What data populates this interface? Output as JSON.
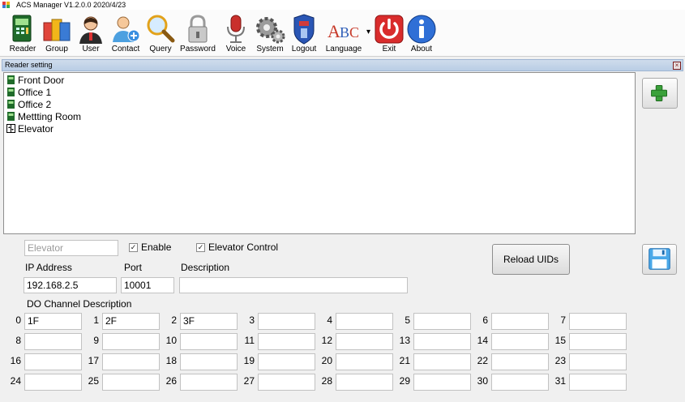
{
  "window": {
    "title": "ACS Manager V1.2.0.0  2020/4/23"
  },
  "toolbar": {
    "items": [
      {
        "label": "Reader"
      },
      {
        "label": "Group"
      },
      {
        "label": "User"
      },
      {
        "label": "Contact"
      },
      {
        "label": "Query"
      },
      {
        "label": "Password"
      },
      {
        "label": "Voice"
      },
      {
        "label": "System"
      },
      {
        "label": "Logout"
      },
      {
        "label": "Language"
      },
      {
        "label": "Exit"
      },
      {
        "label": "About"
      }
    ]
  },
  "panel": {
    "title": "Reader setting"
  },
  "tree": {
    "items": [
      {
        "label": "Front Door"
      },
      {
        "label": "Office 1"
      },
      {
        "label": "Office 2"
      },
      {
        "label": "Mettting Room"
      },
      {
        "label": "Elevator"
      }
    ]
  },
  "form": {
    "name_placeholder": "Elevator",
    "enable_label": "Enable",
    "enable_checked": true,
    "elevator_control_label": "Elevator Control",
    "elevator_control_checked": true,
    "ip_label": "IP Address",
    "ip_value": "192.168.2.5",
    "port_label": "Port",
    "port_value": "10001",
    "description_label": "Description",
    "description_value": "",
    "reload_label": "Reload UIDs",
    "do_label": "DO Channel Description"
  },
  "channels": {
    "numbers": [
      "0",
      "1",
      "2",
      "3",
      "4",
      "5",
      "6",
      "7",
      "8",
      "9",
      "10",
      "11",
      "12",
      "13",
      "14",
      "15",
      "16",
      "17",
      "18",
      "19",
      "20",
      "21",
      "22",
      "23",
      "24",
      "25",
      "26",
      "27",
      "28",
      "29",
      "30",
      "31"
    ],
    "values": [
      "1F",
      "2F",
      "3F",
      "",
      "",
      "",
      "",
      "",
      "",
      "",
      "",
      "",
      "",
      "",
      "",
      "",
      "",
      "",
      "",
      "",
      "",
      "",
      "",
      "",
      "",
      "",
      "",
      "",
      "",
      "",
      "",
      ""
    ]
  },
  "colors": {
    "accent": "#2f6fd6",
    "panel_header": "#c4d5ea",
    "exit_red": "#d92c2c",
    "add_green": "#3aa13a"
  }
}
